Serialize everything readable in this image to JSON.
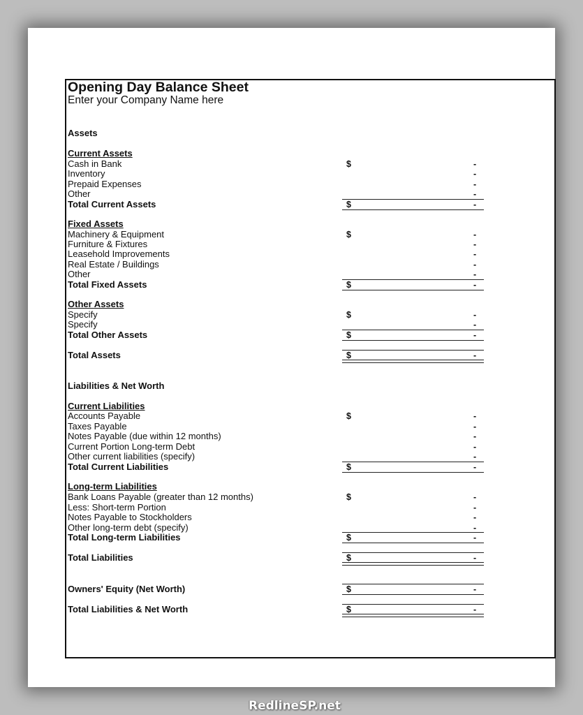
{
  "header": {
    "title": "Opening Day Balance Sheet",
    "subtitle": "Enter your Company Name here"
  },
  "currency_symbol": "$",
  "empty_value": "-",
  "assets": {
    "heading": "Assets",
    "current": {
      "label": "Current Assets",
      "items": [
        "Cash in Bank",
        "Inventory",
        "Prepaid Expenses",
        "Other"
      ],
      "values": [
        "-",
        "-",
        "-",
        "-"
      ],
      "total_label": "Total Current Assets",
      "total_value": "-"
    },
    "fixed": {
      "label": "Fixed Assets",
      "items": [
        "Machinery & Equipment",
        "Furniture & Fixtures",
        "Leasehold Improvements",
        "Real Estate / Buildings",
        "Other"
      ],
      "values": [
        "-",
        "-",
        "-",
        "-",
        "-"
      ],
      "total_label": "Total Fixed Assets",
      "total_value": "-"
    },
    "other": {
      "label": "Other Assets",
      "items": [
        "Specify",
        "Specify"
      ],
      "values": [
        "-",
        "-"
      ],
      "total_label": "Total Other Assets",
      "total_value": "-"
    },
    "total_label": "Total Assets",
    "total_value": "-"
  },
  "liabilities": {
    "heading": "Liabilities & Net Worth",
    "current": {
      "label": "Current Liabilities",
      "items": [
        "Accounts Payable",
        "Taxes Payable",
        "Notes Payable (due within 12 months)",
        "Current Portion Long-term Debt",
        "Other current liabilities (specify)"
      ],
      "values": [
        "-",
        "-",
        "-",
        "-",
        "-"
      ],
      "total_label": "Total Current Liabilities",
      "total_value": "-"
    },
    "long_term": {
      "label": "Long-term Liabilities",
      "items": [
        "Bank Loans Payable (greater than 12 months)",
        "Less: Short-term Portion",
        "Notes Payable to Stockholders",
        "Other long-term debt (specify)"
      ],
      "values": [
        "-",
        "-",
        "-",
        "-"
      ],
      "total_label": "Total Long-term Liabilities",
      "total_value": "-"
    },
    "total_label": "Total Liabilities",
    "total_value": "-",
    "equity_label": "Owners' Equity (Net Worth)",
    "equity_value": "-",
    "grand_total_label": "Total Liabilities & Net Worth",
    "grand_total_value": "-"
  },
  "watermark": "RedlineSP.net"
}
